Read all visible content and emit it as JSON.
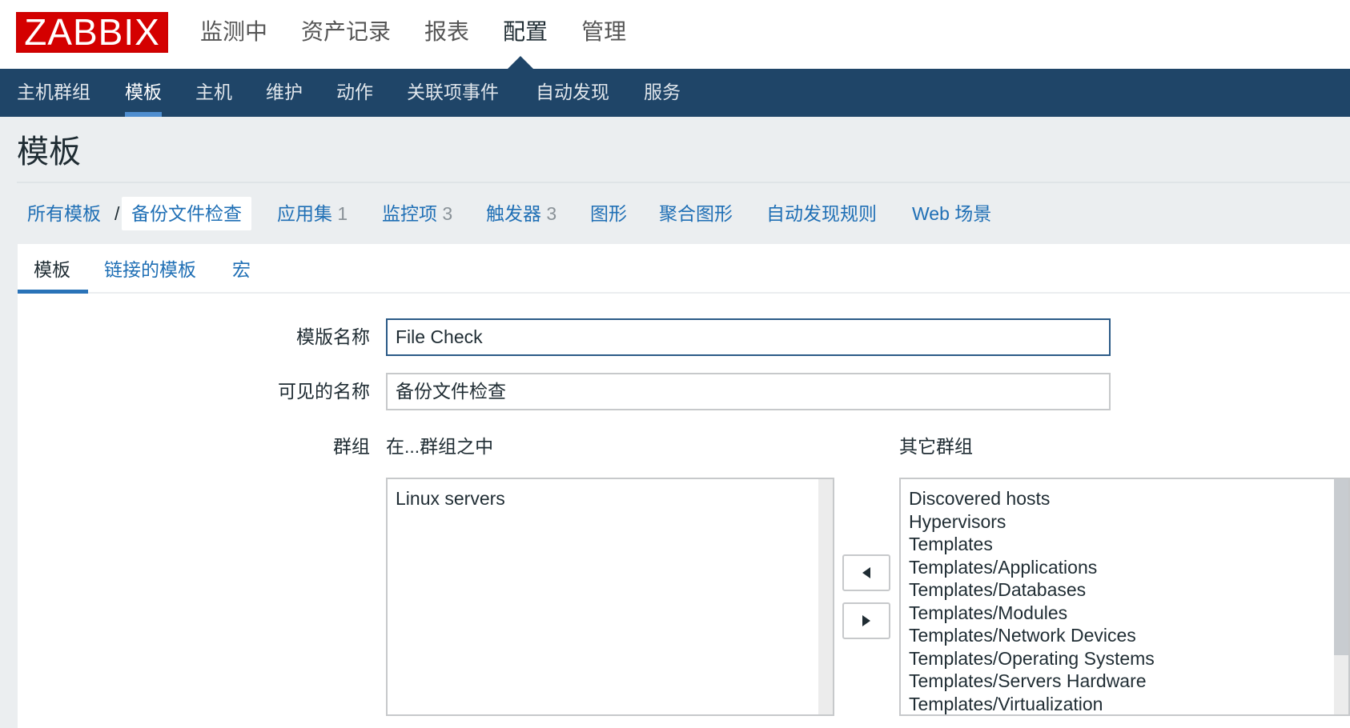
{
  "logo": "ZABBIX",
  "top_nav": [
    {
      "label": "监测中"
    },
    {
      "label": "资产记录"
    },
    {
      "label": "报表"
    },
    {
      "label": "配置",
      "active": true
    },
    {
      "label": "管理"
    }
  ],
  "sub_nav": [
    {
      "label": "主机群组"
    },
    {
      "label": "模板",
      "active": true
    },
    {
      "label": "主机"
    },
    {
      "label": "维护"
    },
    {
      "label": "动作"
    },
    {
      "label": "关联项事件"
    },
    {
      "label": "自动发现"
    },
    {
      "label": "服务"
    }
  ],
  "page_title": "模板",
  "breadcrumbs": {
    "all": "所有模板",
    "sep": "/",
    "current": "备份文件检查",
    "links": [
      {
        "label": "应用集",
        "count": "1"
      },
      {
        "label": "监控项",
        "count": "3"
      },
      {
        "label": "触发器",
        "count": "3"
      },
      {
        "label": "图形"
      },
      {
        "label": "聚合图形"
      },
      {
        "label": "自动发现规则"
      },
      {
        "label": "Web 场景"
      }
    ]
  },
  "tabs": [
    {
      "label": "模板",
      "active": true
    },
    {
      "label": "链接的模板"
    },
    {
      "label": "宏"
    }
  ],
  "form": {
    "template_name_label": "模版名称",
    "template_name_value": "File Check",
    "visible_name_label": "可见的名称",
    "visible_name_value": "备份文件检查",
    "groups_label": "群组",
    "in_groups_label": "在...群组之中",
    "other_groups_label": "其它群组",
    "in_groups": [
      "Linux servers"
    ],
    "other_groups": [
      "Discovered hosts",
      "Hypervisors",
      "Templates",
      "Templates/Applications",
      "Templates/Databases",
      "Templates/Modules",
      "Templates/Network Devices",
      "Templates/Operating Systems",
      "Templates/Servers Hardware",
      "Templates/Virtualization"
    ]
  },
  "colors": {
    "brand": "#d40000",
    "nav": "#1f4568",
    "link": "#1f6fb5",
    "accent": "#2a73b8"
  }
}
